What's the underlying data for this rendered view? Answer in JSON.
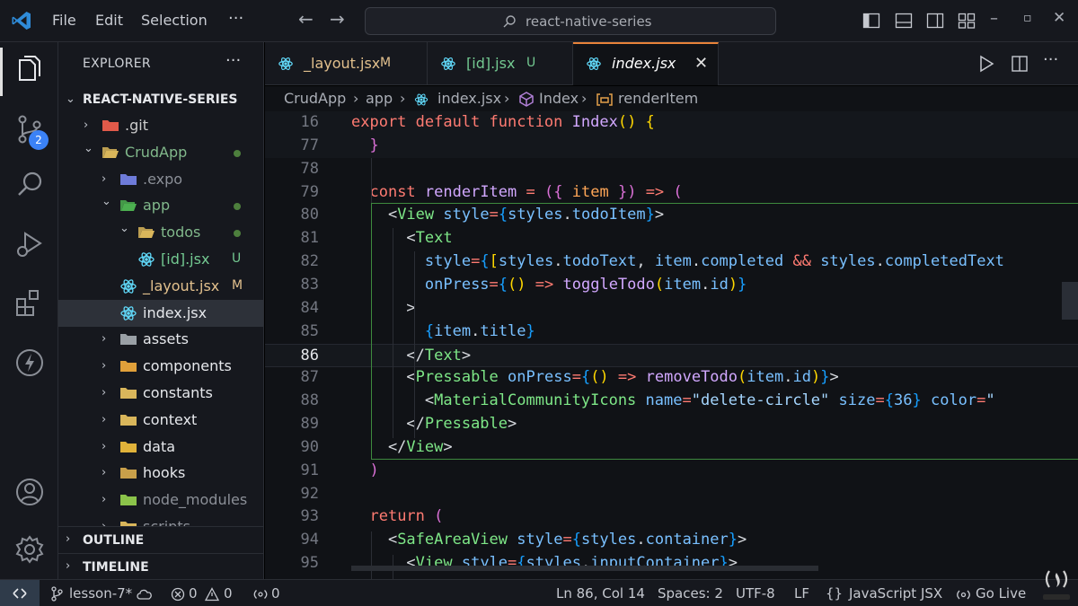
{
  "titlebar": {
    "menu": [
      "File",
      "Edit",
      "Selection"
    ],
    "more": "···",
    "search_text": "react-native-series"
  },
  "activity": {
    "source_control_badge": "2"
  },
  "sidebar": {
    "title": "EXPLORER",
    "more": "···",
    "root": "REACT-NATIVE-SERIES",
    "tree": [
      {
        "name": ".git",
        "status": "",
        "color": "#cccccc",
        "depth": 1,
        "expanded": false,
        "dot": false,
        "kind": "folder-git"
      },
      {
        "name": "CrudApp",
        "status": "",
        "color": "#81b88b",
        "depth": 1,
        "expanded": true,
        "dot": true,
        "kind": "folder"
      },
      {
        "name": ".expo",
        "status": "",
        "color": "#8b8f97",
        "depth": 2,
        "expanded": false,
        "dot": false,
        "kind": "folder-expo"
      },
      {
        "name": "app",
        "status": "",
        "color": "#81b88b",
        "depth": 2,
        "expanded": true,
        "dot": true,
        "kind": "folder-app"
      },
      {
        "name": "todos",
        "status": "",
        "color": "#81b88b",
        "depth": 3,
        "expanded": true,
        "dot": true,
        "kind": "folder"
      },
      {
        "name": "[id].jsx",
        "status": "U",
        "color": "#73c991",
        "depth": 4,
        "file": true,
        "kind": "react"
      },
      {
        "name": "_layout.jsx",
        "status": "M",
        "color": "#e2c08d",
        "depth": 3,
        "file": true,
        "kind": "react"
      },
      {
        "name": "index.jsx",
        "status": "",
        "color": "#e6e8ec",
        "depth": 3,
        "file": true,
        "selected": true,
        "kind": "react"
      },
      {
        "name": "assets",
        "status": "",
        "color": "#e6e8ec",
        "depth": 2,
        "expanded": false,
        "kind": "folder-assets"
      },
      {
        "name": "components",
        "status": "",
        "color": "#e6e8ec",
        "depth": 2,
        "expanded": false,
        "kind": "folder-components"
      },
      {
        "name": "constants",
        "status": "",
        "color": "#e6e8ec",
        "depth": 2,
        "expanded": false,
        "kind": "folder"
      },
      {
        "name": "context",
        "status": "",
        "color": "#e6e8ec",
        "depth": 2,
        "expanded": false,
        "kind": "folder"
      },
      {
        "name": "data",
        "status": "",
        "color": "#e6e8ec",
        "depth": 2,
        "expanded": false,
        "kind": "folder-data"
      },
      {
        "name": "hooks",
        "status": "",
        "color": "#e6e8ec",
        "depth": 2,
        "expanded": false,
        "kind": "folder-hooks"
      },
      {
        "name": "node_modules",
        "status": "",
        "color": "#8b8f97",
        "depth": 2,
        "expanded": false,
        "kind": "folder-node"
      },
      {
        "name": "scripts",
        "status": "",
        "color": "#8b8f97",
        "depth": 2,
        "expanded": false,
        "kind": "folder"
      }
    ],
    "outline": "OUTLINE",
    "timeline": "TIMELINE"
  },
  "tabs": [
    {
      "label": "_layout.jsx",
      "status": "M",
      "label_color": "#e2c08d",
      "status_color": "#e2c08d",
      "active": false
    },
    {
      "label": "[id].jsx",
      "status": "U",
      "label_color": "#73c991",
      "status_color": "#73c991",
      "active": false
    },
    {
      "label": "index.jsx",
      "status": "",
      "label_color": "#ffffff",
      "status_color": "",
      "active": true,
      "close": "✕"
    }
  ],
  "breadcrumb": [
    "CrudApp",
    "app",
    "index.jsx",
    "Index",
    "renderItem"
  ],
  "editor": {
    "current_line": 86,
    "lines": [
      {
        "n": "16",
        "sticky": true,
        "tokens": [
          [
            "t-kw",
            "export default function "
          ],
          [
            "t-fn",
            "Index"
          ],
          [
            "t-br1",
            "() {"
          ]
        ]
      },
      {
        "n": "77",
        "sticky": true,
        "tokens": [
          [
            "t-plain",
            "  "
          ],
          [
            "t-br2",
            "}"
          ]
        ]
      },
      {
        "n": "78",
        "tokens": []
      },
      {
        "n": "79",
        "tokens": [
          [
            "t-plain",
            "  "
          ],
          [
            "t-kw",
            "const "
          ],
          [
            "t-fn",
            "renderItem"
          ],
          [
            "t-plain",
            " "
          ],
          [
            "t-kw",
            "="
          ],
          [
            "t-plain",
            " "
          ],
          [
            "t-br2",
            "({"
          ],
          [
            "t-plain",
            " "
          ],
          [
            "t-var",
            "item"
          ],
          [
            "t-plain",
            " "
          ],
          [
            "t-br2",
            "})"
          ],
          [
            "t-plain",
            " "
          ],
          [
            "t-kw",
            "=>"
          ],
          [
            "t-plain",
            " "
          ],
          [
            "t-br2",
            "("
          ]
        ]
      },
      {
        "n": "80",
        "tokens": [
          [
            "t-plain",
            "    <"
          ],
          [
            "t-tag",
            "View"
          ],
          [
            "t-plain",
            " "
          ],
          [
            "t-attr",
            "style"
          ],
          [
            "t-kw",
            "="
          ],
          [
            "t-br3",
            "{"
          ],
          [
            "t-attr",
            "styles"
          ],
          [
            "t-plain",
            "."
          ],
          [
            "t-attr",
            "todoItem"
          ],
          [
            "t-br3",
            "}"
          ],
          [
            "t-plain",
            ">"
          ]
        ]
      },
      {
        "n": "81",
        "tokens": [
          [
            "t-plain",
            "      <"
          ],
          [
            "t-tag",
            "Text"
          ]
        ]
      },
      {
        "n": "82",
        "tokens": [
          [
            "t-plain",
            "        "
          ],
          [
            "t-attr",
            "style"
          ],
          [
            "t-kw",
            "="
          ],
          [
            "t-br3",
            "{"
          ],
          [
            "t-br1",
            "["
          ],
          [
            "t-attr",
            "styles"
          ],
          [
            "t-plain",
            "."
          ],
          [
            "t-attr",
            "todoText"
          ],
          [
            "t-plain",
            ", "
          ],
          [
            "t-attr",
            "item"
          ],
          [
            "t-plain",
            "."
          ],
          [
            "t-attr",
            "completed"
          ],
          [
            "t-plain",
            " "
          ],
          [
            "t-kw",
            "&&"
          ],
          [
            "t-plain",
            " "
          ],
          [
            "t-attr",
            "styles"
          ],
          [
            "t-plain",
            "."
          ],
          [
            "t-attr",
            "completedText"
          ]
        ]
      },
      {
        "n": "83",
        "tokens": [
          [
            "t-plain",
            "        "
          ],
          [
            "t-attr",
            "onPress"
          ],
          [
            "t-kw",
            "="
          ],
          [
            "t-br3",
            "{"
          ],
          [
            "t-br1",
            "()"
          ],
          [
            "t-plain",
            " "
          ],
          [
            "t-kw",
            "=>"
          ],
          [
            "t-plain",
            " "
          ],
          [
            "t-fn",
            "toggleTodo"
          ],
          [
            "t-br1",
            "("
          ],
          [
            "t-attr",
            "item"
          ],
          [
            "t-plain",
            "."
          ],
          [
            "t-attr",
            "id"
          ],
          [
            "t-br1",
            ")"
          ],
          [
            "t-br3",
            "}"
          ]
        ]
      },
      {
        "n": "84",
        "tokens": [
          [
            "t-plain",
            "      >"
          ]
        ]
      },
      {
        "n": "85",
        "tokens": [
          [
            "t-plain",
            "        "
          ],
          [
            "t-br3",
            "{"
          ],
          [
            "t-attr",
            "item"
          ],
          [
            "t-plain",
            "."
          ],
          [
            "t-attr",
            "title"
          ],
          [
            "t-br3",
            "}"
          ]
        ]
      },
      {
        "n": "86",
        "tokens": [
          [
            "t-plain",
            "      </"
          ],
          [
            "t-tag",
            "Text"
          ],
          [
            "t-plain",
            ">"
          ]
        ]
      },
      {
        "n": "87",
        "tokens": [
          [
            "t-plain",
            "      <"
          ],
          [
            "t-tag",
            "Pressable"
          ],
          [
            "t-plain",
            " "
          ],
          [
            "t-attr",
            "onPress"
          ],
          [
            "t-kw",
            "="
          ],
          [
            "t-br3",
            "{"
          ],
          [
            "t-br1",
            "()"
          ],
          [
            "t-plain",
            " "
          ],
          [
            "t-kw",
            "=>"
          ],
          [
            "t-plain",
            " "
          ],
          [
            "t-fn",
            "removeTodo"
          ],
          [
            "t-br1",
            "("
          ],
          [
            "t-attr",
            "item"
          ],
          [
            "t-plain",
            "."
          ],
          [
            "t-attr",
            "id"
          ],
          [
            "t-br1",
            ")"
          ],
          [
            "t-br3",
            "}"
          ],
          [
            "t-plain",
            ">"
          ]
        ]
      },
      {
        "n": "88",
        "tokens": [
          [
            "t-plain",
            "        <"
          ],
          [
            "t-tag",
            "MaterialCommunityIcons"
          ],
          [
            "t-plain",
            " "
          ],
          [
            "t-attr",
            "name"
          ],
          [
            "t-kw",
            "="
          ],
          [
            "t-str",
            "\"delete-circle\""
          ],
          [
            "t-plain",
            " "
          ],
          [
            "t-attr",
            "size"
          ],
          [
            "t-kw",
            "="
          ],
          [
            "t-br3",
            "{"
          ],
          [
            "t-num",
            "36"
          ],
          [
            "t-br3",
            "}"
          ],
          [
            "t-plain",
            " "
          ],
          [
            "t-attr",
            "color"
          ],
          [
            "t-kw",
            "="
          ],
          [
            "t-str",
            "\""
          ]
        ]
      },
      {
        "n": "89",
        "tokens": [
          [
            "t-plain",
            "      </"
          ],
          [
            "t-tag",
            "Pressable"
          ],
          [
            "t-plain",
            ">"
          ]
        ]
      },
      {
        "n": "90",
        "tokens": [
          [
            "t-plain",
            "    </"
          ],
          [
            "t-tag",
            "View"
          ],
          [
            "t-plain",
            ">"
          ]
        ]
      },
      {
        "n": "91",
        "tokens": [
          [
            "t-plain",
            "  "
          ],
          [
            "t-br2",
            ")"
          ]
        ]
      },
      {
        "n": "92",
        "tokens": []
      },
      {
        "n": "93",
        "tokens": [
          [
            "t-plain",
            "  "
          ],
          [
            "t-kw",
            "return"
          ],
          [
            "t-plain",
            " "
          ],
          [
            "t-br2",
            "("
          ]
        ]
      },
      {
        "n": "94",
        "tokens": [
          [
            "t-plain",
            "    <"
          ],
          [
            "t-tag",
            "SafeAreaView"
          ],
          [
            "t-plain",
            " "
          ],
          [
            "t-attr",
            "style"
          ],
          [
            "t-kw",
            "="
          ],
          [
            "t-br3",
            "{"
          ],
          [
            "t-attr",
            "styles"
          ],
          [
            "t-plain",
            "."
          ],
          [
            "t-attr",
            "container"
          ],
          [
            "t-br3",
            "}"
          ],
          [
            "t-plain",
            ">"
          ]
        ]
      },
      {
        "n": "95",
        "tokens": [
          [
            "t-plain",
            "      <"
          ],
          [
            "t-tag",
            "View"
          ],
          [
            "t-plain",
            " "
          ],
          [
            "t-attr",
            "style"
          ],
          [
            "t-kw",
            "="
          ],
          [
            "t-br3",
            "{"
          ],
          [
            "t-attr",
            "styles"
          ],
          [
            "t-plain",
            "."
          ],
          [
            "t-attr",
            "inputContainer"
          ],
          [
            "t-br3",
            "}"
          ],
          [
            "t-plain",
            ">"
          ]
        ]
      }
    ]
  },
  "statusbar": {
    "branch": "lesson-7*",
    "errors": "0",
    "warnings": "0",
    "ports": "0",
    "position": "Ln 86, Col 14",
    "spaces": "Spaces: 2",
    "encoding": "UTF-8",
    "eol": "LF",
    "language": "JavaScript JSX",
    "golive": "Go Live"
  },
  "colors": {
    "accent": "#e8833a",
    "git_added": "#73c991",
    "git_modified": "#e2c08d",
    "badge": "#3b82f6"
  }
}
